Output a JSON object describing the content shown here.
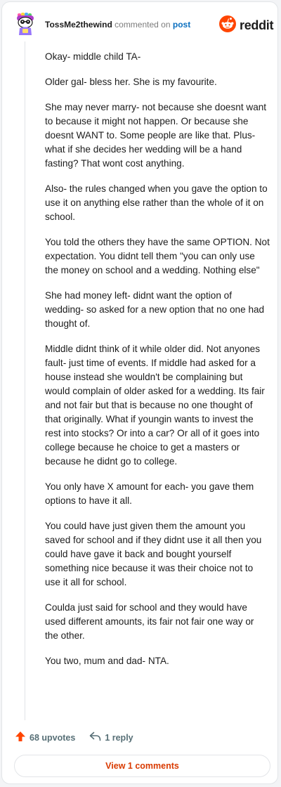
{
  "header": {
    "username": "TossMe2thewind",
    "action_text": "commented on",
    "link_text": "post",
    "logo_text": "reddit"
  },
  "comment": {
    "paragraphs": [
      "Okay- middle child TA-",
      "Older gal- bless her. She is my favourite.",
      "She may never marry- not because she doesnt want to because it might not happen. Or because she doesnt WANT to. Some people are like that. Plus- what if she decides her wedding will be a hand fasting? That wont cost anything.",
      "Also- the rules changed when you gave the option to use it on anything else rather than the whole of it on school.",
      "You told the others they have the same OPTION. Not expectation. You didnt tell them \"you can only use the money on school and a wedding. Nothing else\"",
      "She had money left- didnt want the option of wedding- so asked for a new option that no one had thought of.",
      "Middle didnt think of it while older did. Not anyones fault- just time of events. If middle had asked for a house instead she wouldn't be complaining but would complain of older asked for a wedding. Its fair and not fair but that is because no one thought of that originally. What if youngin wants to invest the rest into stocks? Or into a car? Or all of it goes into college because he choice to get a masters or because he didnt go to college.",
      "You only have X amount for each- you gave them options to have it all.",
      "You could have just given them the amount you saved for school and if they didnt use it all then you could have gave it back and bought yourself something nice because it was their choice not to use it all for school.",
      "Coulda just said for school and they would have used different amounts, its fair not fair one way or the other.",
      "You two, mum and dad- NTA."
    ]
  },
  "actions": {
    "upvotes": "68 upvotes",
    "replies": "1 reply"
  },
  "view_comments_label": "View 1 comments",
  "icons": {
    "avatar": "avatar-icon",
    "logo": "reddit-alien-icon",
    "upvote": "upvote-arrow-icon",
    "reply": "reply-arrow-icon"
  },
  "colors": {
    "accent": "#ff4500",
    "link": "#0b6fbf",
    "button_text": "#d93a00",
    "muted": "#576f76"
  }
}
